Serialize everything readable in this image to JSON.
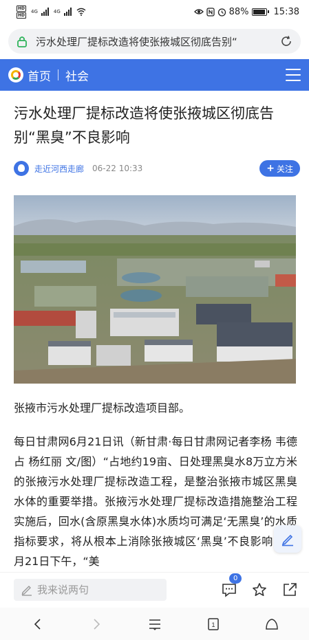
{
  "status_bar": {
    "network_tag_1": "HD",
    "network_tag_2": "HD",
    "signal_1_label": "4G",
    "signal_2_label": "4G",
    "battery_percent": "88%",
    "battery_level": 0.88,
    "time": "15:38"
  },
  "url_bar": {
    "page_title": "污水处理厂提标改造将使张掖城区彻底告别“"
  },
  "site_header": {
    "home_label": "首页",
    "section_label": "社会"
  },
  "article": {
    "title": "污水处理厂提标改造将使张掖城区彻底告别“黑臭”不良影响",
    "author": "走近河西走廊",
    "published_at": "06-22 10:33",
    "follow_label": "关注",
    "photo_caption": "张掖市污水处理厂提标改造项目部。",
    "body": "每日甘肃网6月21日讯（新甘肃·每日甘肃网记者李杨 韦德占 杨红丽 文/图）“占地约19亩、日处理黑臭水8万立方米的张掖污水处理厂提标改造工程，是整治张掖市城区黑臭水体的重要举措。张掖污水处理厂提标改造措施整治工程实施后，回水(含原黑臭水体)水质均可满足‘无黑臭’的水质指标要求，将从根本上消除张掖城区‘黑臭’不良影响！”6月21日下午，“美"
  },
  "comment_bar": {
    "placeholder": "我来说两句",
    "comment_count": "0"
  },
  "icons": {
    "lock": "lock-icon",
    "reload": "reload-icon",
    "menu": "menu-icon",
    "pencil": "pencil-icon",
    "comment": "comment-icon",
    "star": "star-icon",
    "share": "share-icon",
    "back": "back-icon",
    "forward": "forward-icon",
    "browser_menu": "browser-menu-icon",
    "tabs": "tabs-icon",
    "home": "home-icon"
  },
  "colors": {
    "brand_blue": "#3e73e4",
    "lock_green": "#2fb35b"
  },
  "browser_nav": {
    "tab_count": "1"
  }
}
